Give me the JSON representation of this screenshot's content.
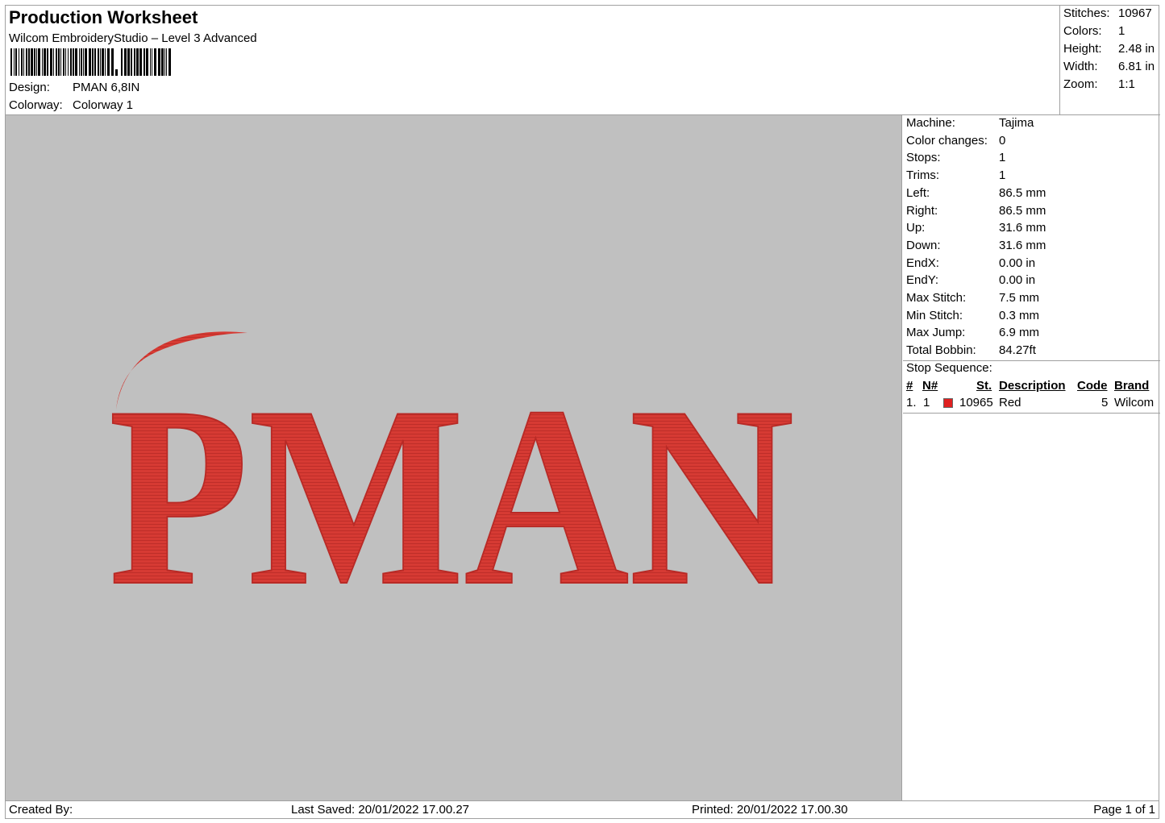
{
  "header": {
    "title": "Production Worksheet",
    "subtitle": "Wilcom EmbroideryStudio – Level 3 Advanced",
    "design_label": "Design:",
    "design_value": "PMAN 6,8IN",
    "colorway_label": "Colorway:",
    "colorway_value": "Colorway 1"
  },
  "summary": {
    "stitches_label": "Stitches:",
    "stitches_value": "10967",
    "colors_label": "Colors:",
    "colors_value": "1",
    "height_label": "Height:",
    "height_value": "2.48 in",
    "width_label": "Width:",
    "width_value": "6.81 in",
    "zoom_label": "Zoom:",
    "zoom_value": "1:1"
  },
  "design_preview": {
    "text": "PMAN",
    "thread_color": "#d63a33",
    "background_color": "#c0c0c0"
  },
  "machine_info": [
    {
      "label": "Machine:",
      "value": "Tajima"
    },
    {
      "label": "Color changes:",
      "value": "0"
    },
    {
      "label": "Stops:",
      "value": "1"
    },
    {
      "label": "Trims:",
      "value": "1"
    },
    {
      "label": "Left:",
      "value": "86.5 mm"
    },
    {
      "label": "Right:",
      "value": "86.5 mm"
    },
    {
      "label": "Up:",
      "value": "31.6 mm"
    },
    {
      "label": "Down:",
      "value": "31.6 mm"
    },
    {
      "label": "EndX:",
      "value": "0.00 in"
    },
    {
      "label": "EndY:",
      "value": "0.00 in"
    },
    {
      "label": "Max Stitch:",
      "value": "7.5 mm"
    },
    {
      "label": "Min Stitch:",
      "value": "0.3 mm"
    },
    {
      "label": "Max Jump:",
      "value": "6.9 mm"
    },
    {
      "label": "Total Bobbin:",
      "value": "84.27ft"
    }
  ],
  "stop_sequence": {
    "title": "Stop Sequence:",
    "columns": {
      "num": "#",
      "needle": "N#",
      "stitches": "St.",
      "description": "Description",
      "code": "Code",
      "brand": "Brand"
    },
    "rows": [
      {
        "num": "1.",
        "needle": "1",
        "swatch_color": "#e02020",
        "stitches": "10965",
        "description": "Red",
        "code": "5",
        "brand": "Wilcom"
      }
    ]
  },
  "footer": {
    "created_by": "Created By:",
    "last_saved": "Last Saved: 20/01/2022 17.00.27",
    "printed": "Printed: 20/01/2022 17.00.30",
    "page": "Page 1 of 1"
  }
}
